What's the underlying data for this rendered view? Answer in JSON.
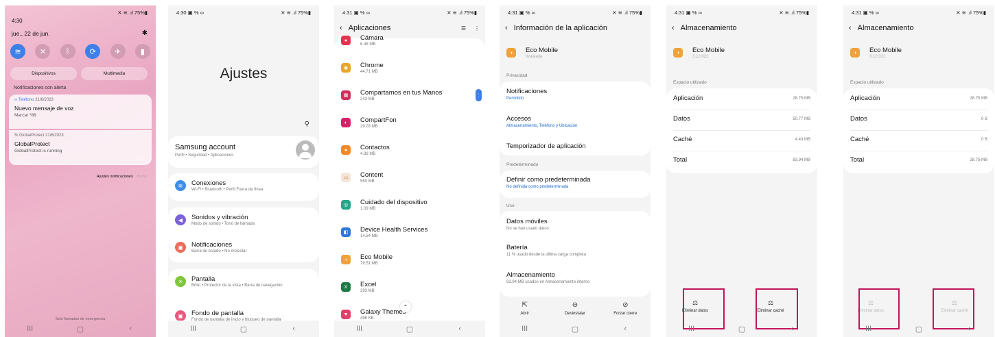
{
  "phone1": {
    "time": "4:30",
    "status_right": "✕ ≋ .ıl 75%▮",
    "date": "jue., 22 de jun.",
    "toggles": [
      {
        "icon": "wifi-icon",
        "glyph": "≋",
        "on": true
      },
      {
        "icon": "mute-icon",
        "glyph": "✕",
        "on": false
      },
      {
        "icon": "bluetooth-icon",
        "glyph": "ᛒ",
        "on": false
      },
      {
        "icon": "autorotate-icon",
        "glyph": "⟳",
        "on": true
      },
      {
        "icon": "airplane-icon",
        "glyph": "✈",
        "on": false
      },
      {
        "icon": "flashlight-icon",
        "glyph": "▮",
        "on": false
      }
    ],
    "devices_label": "Dispositivos",
    "media_label": "Multimedia",
    "alerts_header": "Notificaciones con alerta",
    "notif1": {
      "app": "∞ Teléfono",
      "date": " 21/6/2023",
      "title": "Nuevo mensaje de voz",
      "sub": "Marcar *86"
    },
    "notif2": {
      "app": "% GlobalProtect",
      "date": " 21/6/2023",
      "title": "GlobalProtect",
      "sub": "GlobalProtect is running"
    },
    "notif_settings": "Ajustes notificaciones",
    "clear": "Borrar",
    "emergency": "Solo llamadas de emergencia"
  },
  "phone2": {
    "time": "4:30 ▣ % ∞",
    "status_right": "✕ ≋ .ıl 75%▮",
    "title": "Ajustes",
    "account": {
      "title": "Samsung account",
      "sub": "Perfil  •  Seguridad  •  Aplicaciones"
    },
    "items": [
      {
        "title": "Conexiones",
        "sub": "Wi-Fi  •  Bluetooth  •  Perfil Fuera de línea",
        "color": "#3e8ee8",
        "glyph": "≋"
      },
      {
        "title": "Sonidos y vibración",
        "sub": "Modo de sonido  •  Tono de llamada",
        "color": "#7b62d8",
        "glyph": "◀"
      },
      {
        "title": "Notificaciones",
        "sub": "Barra de estado  •  No molestar",
        "color": "#ef6a5a",
        "glyph": "▣"
      },
      {
        "title": "Pantalla",
        "sub": "Brillo  •  Protector de la vista  •  Barra de navegación",
        "color": "#7fc63a",
        "glyph": "☀"
      },
      {
        "title": "Fondo de pantalla",
        "sub": "Fondo de pantalla de inicio y bloqueo de pantalla",
        "color": "#e8577e",
        "glyph": "▣"
      }
    ]
  },
  "phone3": {
    "time": "4:31 ▣ % ∞",
    "status_right": "✕ ≋ .ıl 75%▮",
    "title": "Aplicaciones",
    "apps": [
      {
        "name": "Cámara",
        "size": "6.48 MB",
        "color": "#e2334f",
        "glyph": "●"
      },
      {
        "name": "Chrome",
        "size": "44.71 MB",
        "color": "#e8a72a",
        "glyph": "◉"
      },
      {
        "name": "Compartamos en tus Manos",
        "size": "243 MB",
        "color": "#d0305a",
        "glyph": "▦"
      },
      {
        "name": "CompartFon",
        "size": "29.03 MB",
        "color": "#d8206a",
        "glyph": "◐"
      },
      {
        "name": "Contactos",
        "size": "4.88 MB",
        "color": "#f08a2a",
        "glyph": "●"
      },
      {
        "name": "Content",
        "size": "550 MB",
        "color": "#f3e6d8",
        "glyph": "▭"
      },
      {
        "name": "Cuidado del dispositivo",
        "size": "1.09 MB",
        "color": "#1fa88a",
        "glyph": "◎"
      },
      {
        "name": "Device Health Services",
        "size": "14.54 MB",
        "color": "#2f7ad8",
        "glyph": "◧"
      },
      {
        "name": "Eco Mobile",
        "size": "79.51 MB",
        "color": "#f0a23a",
        "glyph": "◑"
      },
      {
        "name": "Excel",
        "size": "293 MB",
        "color": "#1e7a45",
        "glyph": "X"
      },
      {
        "name": "Galaxy Themes",
        "size": "496 KB",
        "color": "#e43e6a",
        "glyph": "▼"
      }
    ]
  },
  "phone4": {
    "time": "4:31 ▣ % ∞",
    "status_right": "✕ ≋ .ıl 75%▮",
    "title": "Información de la aplicación",
    "app_name": "Eco Mobile",
    "app_status": "Instalada",
    "sec_privacy": "Privacidad",
    "notif": {
      "t": "Notificaciones",
      "s": "Permitido"
    },
    "access": {
      "t": "Accesos",
      "s": "Almacenamiento, Teléfono y Ubicación"
    },
    "timer": {
      "t": "Temporizador de aplicación"
    },
    "sec_default": "Predeterminado",
    "default": {
      "t": "Definir como predeterminada",
      "s": "No definida como predeterminada"
    },
    "sec_use": "Uso",
    "mobile": {
      "t": "Datos móviles",
      "s": "No se han usado datos"
    },
    "battery": {
      "t": "Batería",
      "s": "11 % usado desde la última carga completa"
    },
    "storage": {
      "t": "Almacenamiento",
      "s": "83.94 MB usados en Almacenamiento interno"
    },
    "open": "Abrir",
    "uninstall": "Desinstalar",
    "force_stop": "Forzar cierre"
  },
  "phone5": {
    "time": "4:31 ▣ % ∞",
    "status_right": "✕ ≋ .ıl 75%▮",
    "title": "Almacenamiento",
    "app_name": "Eco Mobile",
    "version": "3.12.022",
    "section": "Espacio utilizado",
    "rows": [
      {
        "k": "Aplicación",
        "v": "28.75 MB"
      },
      {
        "k": "Datos",
        "v": "50.77 MB"
      },
      {
        "k": "Caché",
        "v": "4.43 MB"
      },
      {
        "k": "Total",
        "v": "83.94 MB"
      }
    ],
    "clear_data": "Eliminar datos",
    "clear_cache": "Eliminar caché"
  },
  "phone6": {
    "time": "4:31 ▣ % ∞",
    "status_right": "✕ ≋ .ıl 75%▮",
    "title": "Almacenamiento",
    "app_name": "Eco Mobile",
    "version": "3.12.022",
    "section": "Espacio utilizado",
    "rows": [
      {
        "k": "Aplicación",
        "v": "28.75 MB"
      },
      {
        "k": "Datos",
        "v": "0 B"
      },
      {
        "k": "Caché",
        "v": "0 B"
      },
      {
        "k": "Total",
        "v": "28.75 MB"
      }
    ],
    "clear_data": "Eliminar datos",
    "clear_cache": "Eliminar caché"
  },
  "nav": {
    "recents": "III",
    "home": "▢",
    "back": "‹"
  },
  "colors": {
    "highlight": "#c4145a",
    "accent": "#3e7fe8"
  }
}
